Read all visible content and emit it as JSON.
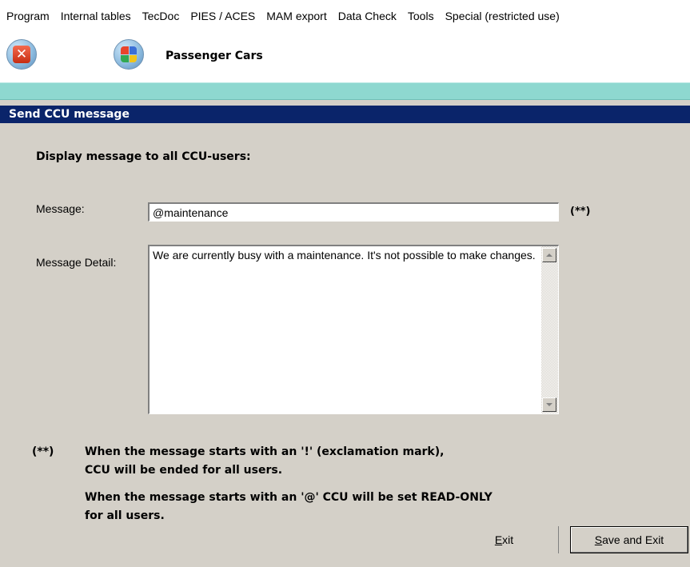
{
  "menubar": {
    "items": [
      {
        "label": "Program"
      },
      {
        "label": "Internal tables"
      },
      {
        "label": "TecDoc"
      },
      {
        "label": "PIES / ACES"
      },
      {
        "label": "MAM export"
      },
      {
        "label": "Data Check"
      },
      {
        "label": "Tools"
      },
      {
        "label": "Special (restricted use)"
      }
    ]
  },
  "toolbar": {
    "close_icon": "close-red-x-icon",
    "module_icon": "colored-quad-icon",
    "module_title": "Passenger Cars"
  },
  "dialog": {
    "title": "Send CCU message",
    "heading": "Display message to all CCU-users:",
    "message_label": "Message:",
    "message_value": "@maintenance",
    "required_mark": "(**)",
    "detail_label": "Message Detail:",
    "detail_value": "We are currently busy with a maintenance. It's not possible to make changes.",
    "note_mark": "(**)",
    "note_line1": "When the message starts with an '!' (exclamation mark),",
    "note_line2": "CCU will be ended for all users.",
    "note_line3": "When the message starts with an '@' CCU will be set READ-ONLY",
    "note_line4": "for all users."
  },
  "buttons": {
    "exit_mnemonic": "E",
    "exit_rest": "xit",
    "save_mnemonic": "S",
    "save_rest": "ave and Exit"
  },
  "colors": {
    "title_bar": "#0a246a",
    "accent_strip": "#8ed8d0",
    "dialog_bg": "#d4d0c8"
  }
}
